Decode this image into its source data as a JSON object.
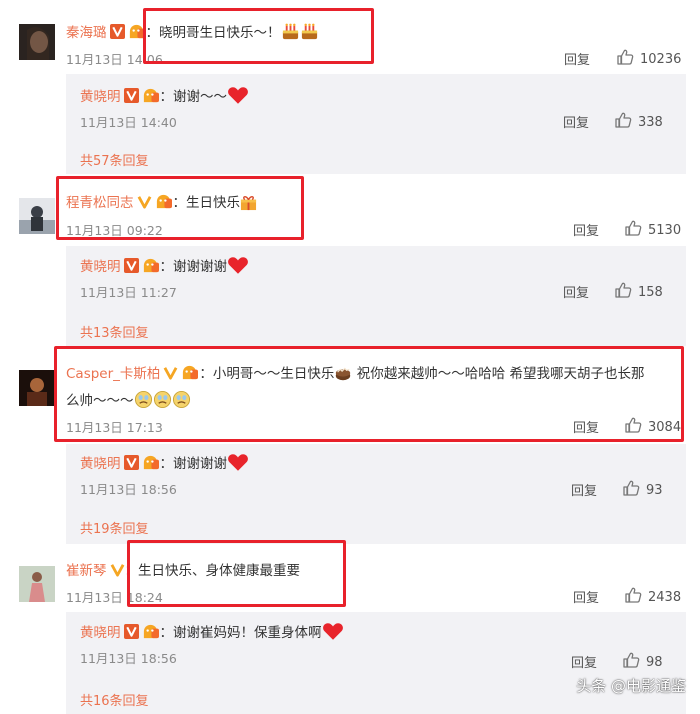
{
  "comments": [
    {
      "username": "秦海璐",
      "text": "：晓明哥生日快乐～！",
      "time": "11月13日 14:06",
      "reply_label": "回复",
      "likes": "10236",
      "reply": {
        "username": "黄晓明",
        "text": "：谢谢～～",
        "time": "11月13日 14:40",
        "reply_label": "回复",
        "likes": "338"
      },
      "more_replies": "共57条回复"
    },
    {
      "username": "程青松同志",
      "text": "：生日快乐",
      "time": "11月13日 09:22",
      "reply_label": "回复",
      "likes": "5130",
      "reply": {
        "username": "黄晓明",
        "text": "：谢谢谢谢",
        "time": "11月13日 11:27",
        "reply_label": "回复",
        "likes": "158"
      },
      "more_replies": "共13条回复"
    },
    {
      "username": "Casper_卡斯柏",
      "text": "：小明哥～～生日快乐",
      "text_cont": " 祝你越来越帅～～哈哈哈 希望我哪天胡子也长那",
      "text_line2": "么帅～～～",
      "time": "11月13日 17:13",
      "reply_label": "回复",
      "likes": "3084",
      "reply": {
        "username": "黄晓明",
        "text": "：谢谢谢谢",
        "time": "11月13日 18:56",
        "reply_label": "回复",
        "likes": "93"
      },
      "more_replies": "共19条回复"
    },
    {
      "username": "崔新琴",
      "text": "：生日快乐、身体健康最重要",
      "time": "11月13日 18:24",
      "reply_label": "回复",
      "likes": "2438",
      "reply": {
        "username": "黄晓明",
        "text": "：谢谢崔妈妈！保重身体啊",
        "time": "11月13日 18:56",
        "reply_label": "回复",
        "likes": "98"
      },
      "more_replies": "共16条回复"
    }
  ],
  "watermark": "头条 @电影通鉴",
  "colors": {
    "username": "#eb7350",
    "highlight": "#e8212b",
    "reply_bg": "#f2f2f5",
    "meta": "#8a8a8a"
  }
}
